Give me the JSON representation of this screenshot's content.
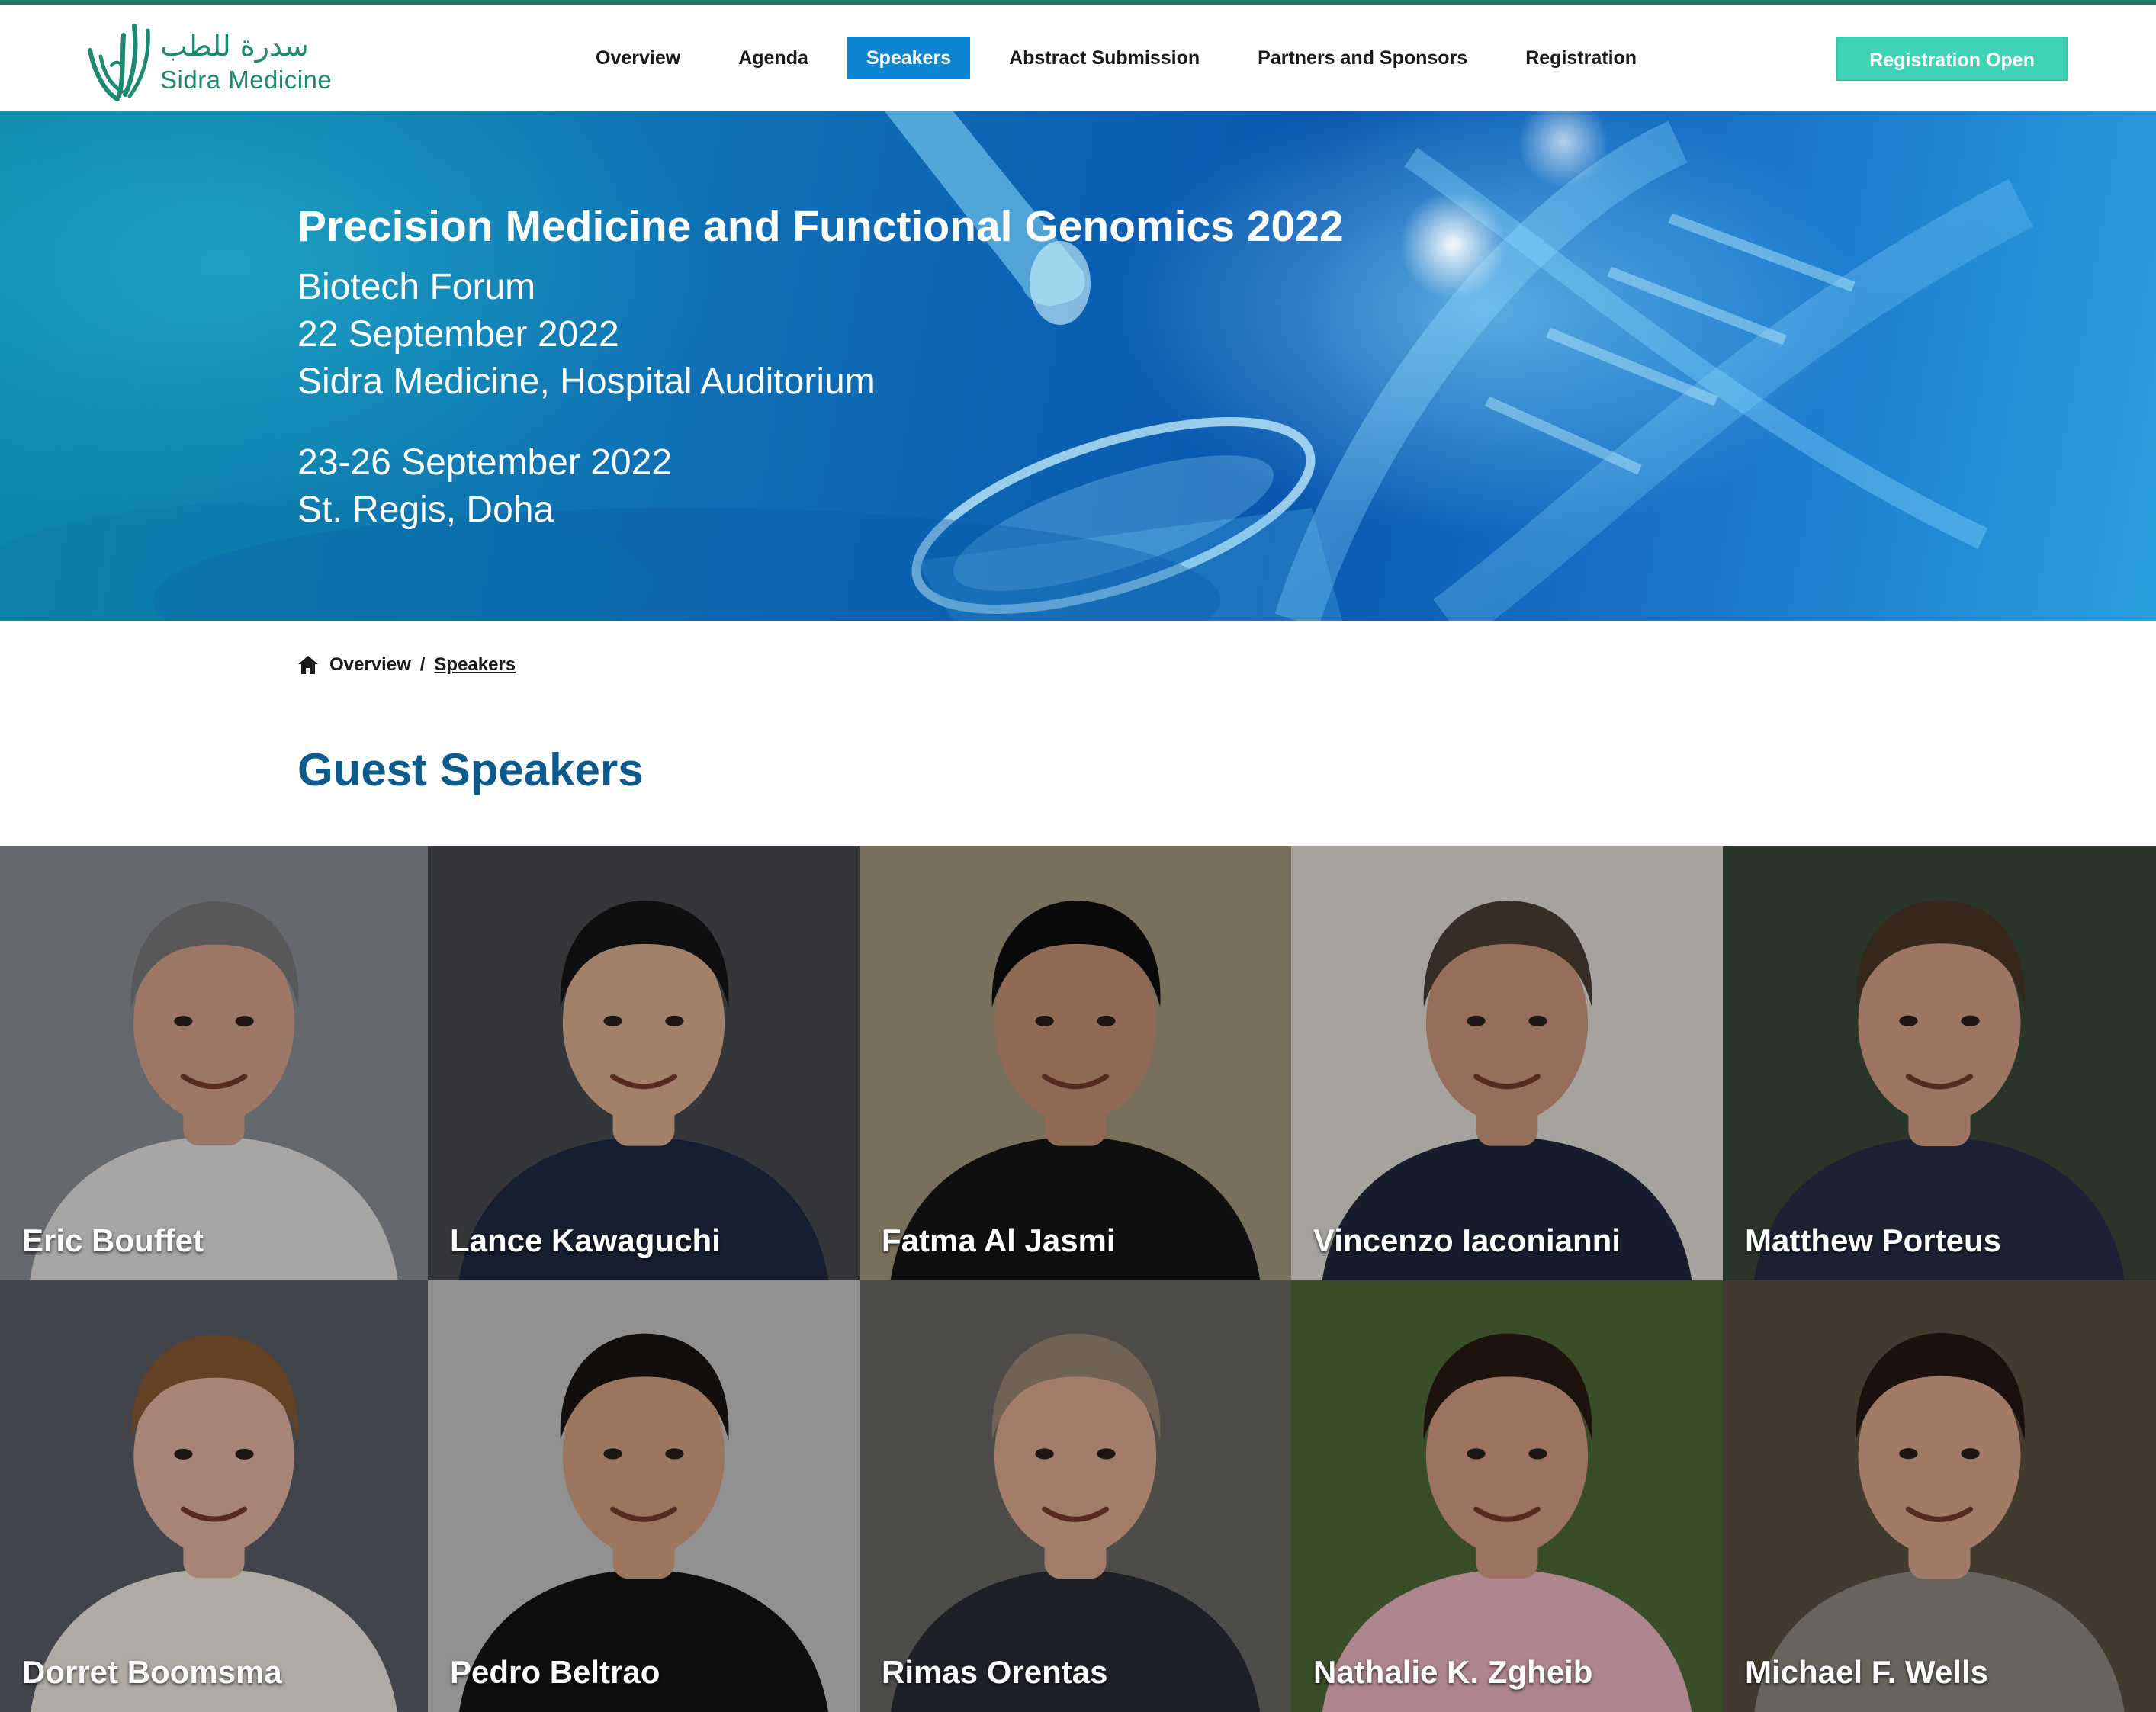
{
  "logo": {
    "arabic": "سدرة للطب",
    "name": "Sidra Medicine"
  },
  "nav": {
    "items": [
      {
        "label": "Overview"
      },
      {
        "label": "Agenda"
      },
      {
        "label": "Speakers",
        "active": true
      },
      {
        "label": "Abstract Submission"
      },
      {
        "label": "Partners and Sponsors"
      },
      {
        "label": "Registration"
      }
    ],
    "cta": "Registration Open"
  },
  "hero": {
    "title": "Precision Medicine and Functional Genomics 2022",
    "forum": "Biotech Forum",
    "forum_date": "22 September 2022",
    "forum_venue": "Sidra Medicine, Hospital Auditorium",
    "main_date": "23-26 September 2022",
    "main_venue": "St. Regis, Doha"
  },
  "breadcrumb": {
    "home": "Overview",
    "separator": "/",
    "current": "Speakers"
  },
  "section": {
    "title": "Guest Speakers"
  },
  "speakers": [
    {
      "name": "Eric Bouffet",
      "bg": "#8d9197",
      "skin": "#d9a58c",
      "hair": "#7a7a7a",
      "shirt": "#e9e6e3"
    },
    {
      "name": "Lance Kawaguchi",
      "bg": "#4a4b4f",
      "skin": "#e0b393",
      "hair": "#161616",
      "shirt": "#1f2a44"
    },
    {
      "name": "Fatma Al Jasmi",
      "bg": "#a89a82",
      "skin": "#c99478",
      "hair": "#0f0f0f",
      "shirt": "#151515"
    },
    {
      "name": "Vincenzo Iaconianni",
      "bg": "#e6e2dc",
      "skin": "#cf9a7f",
      "hair": "#4b3f33",
      "shirt": "#1f2a3f"
    },
    {
      "name": "Matthew Porteus",
      "bg": "#3b4a3a",
      "skin": "#d8a48a",
      "hair": "#4a3626",
      "shirt": "#243048"
    },
    {
      "name": "Dorret Boomsma",
      "bg": "#5a6068",
      "skin": "#e7b9a5",
      "hair": "#8a5a33",
      "shirt": "#f3ece2"
    },
    {
      "name": "Pedro Beltrao",
      "bg": "#c9c9c9",
      "skin": "#d9a283",
      "hair": "#1a1410",
      "shirt": "#141414"
    },
    {
      "name": "Rimas Orentas",
      "bg": "#6d6a66",
      "skin": "#dfae93",
      "hair": "#9b8a74",
      "shirt": "#2a2d38"
    },
    {
      "name": "Nathalie K. Zgheib",
      "bg": "#4f6b3a",
      "skin": "#d7a086",
      "hair": "#2a1a12",
      "shirt": "#f0b9c4"
    },
    {
      "name": "Michael F. Wells",
      "bg": "#5b5142",
      "skin": "#e0ab8e",
      "hair": "#241812",
      "shirt": "#8f8a82"
    }
  ],
  "colors": {
    "accent": "#0f86d2",
    "cta": "#3fd3b5",
    "title": "#0d5a8c",
    "brand": "#1b8a71"
  }
}
